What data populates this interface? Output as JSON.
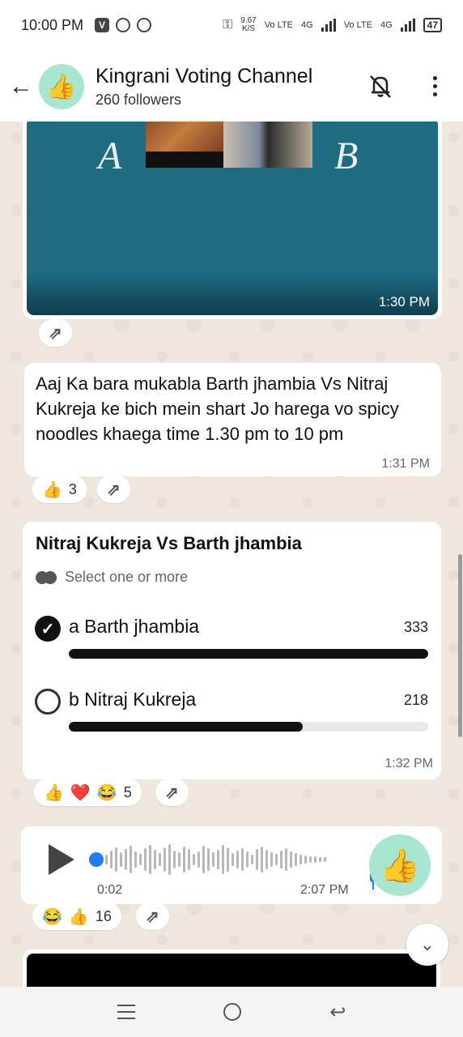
{
  "status_bar": {
    "time": "10:00 PM",
    "net_speed": "9.67",
    "net_unit": "K/S",
    "lte1": "Vo LTE",
    "g1": "4G",
    "lte2": "Vo LTE",
    "g2": "4G",
    "battery": "47"
  },
  "header": {
    "back_icon": "←",
    "avatar_emoji": "👍",
    "title": "Kingrani Voting Channel",
    "followers": "260 followers"
  },
  "image_message": {
    "letter_a": "A",
    "letter_b": "B",
    "time": "1:30 PM"
  },
  "text_message": {
    "text": "Aaj Ka bara mukabla Barth jhambia Vs Nitraj Kukreja ke bich mein shart Jo harega vo spicy noodles khaega time 1.30 pm to 10 pm",
    "time": "1:31 PM",
    "reaction_emoji": "👍",
    "reaction_count": "3"
  },
  "poll": {
    "question": "Nitraj Kukreja Vs Barth jhambia",
    "hint": "Select one or more",
    "options": [
      {
        "label": "a Barth jhambia",
        "count": "333",
        "checked": true,
        "fraction": 1.0
      },
      {
        "label": "b Nitraj Kukreja",
        "count": "218",
        "checked": false,
        "fraction": 0.65
      }
    ],
    "time": "1:32 PM",
    "reactions": [
      "👍",
      "❤️",
      "😂"
    ],
    "reaction_count": "5"
  },
  "voice_message": {
    "elapsed": "0:02",
    "time": "2:07 PM",
    "avatar_emoji": "👍",
    "reactions": [
      "😂",
      "👍"
    ],
    "reaction_count": "16"
  },
  "forward_icon": "⇗",
  "scroll_down_icon": "⌄",
  "colors": {
    "header_bg": "#ffffff",
    "avatar_bg": "#a8e6cf",
    "image_bg": "#1f6b82",
    "accent_blue": "#1d7ff0"
  }
}
